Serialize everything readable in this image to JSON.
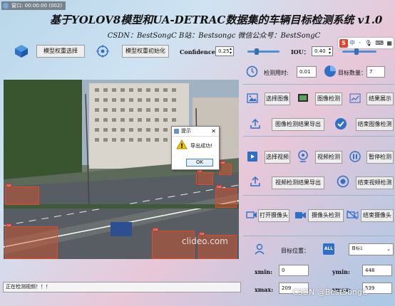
{
  "window": {
    "title": "窗口: 00:00:00 (002)"
  },
  "header": {
    "title": "基于YOLOV8模型和UA-DETRAC数据集的车辆目标检测系统 v1.0",
    "subtitle": "CSDN：BestSongC   B站：Bestsongc   微信公众号：BestSongC"
  },
  "toolbar": {
    "model_select": "模型权重选择",
    "model_init": "模型权重初始化",
    "confidence_label": "Confidence:",
    "confidence_value": "0.25",
    "confidence_level": 0.25,
    "iou_label": "IOU：",
    "iou_value": "0.40",
    "iou_level": 0.4
  },
  "ime": {
    "brand": "S",
    "lang": "中"
  },
  "stats": {
    "time_label": "检测用时:",
    "time_value": "0.01",
    "count_label": "目标数量：",
    "count_value": "7"
  },
  "image_panel": {
    "select_image": "选择图像",
    "detect_image": "图像检测",
    "show_result": "结果展示",
    "export_image": "图像检测结果导出",
    "end_image": "结束图像检测"
  },
  "video_panel": {
    "select_video": "选择视频",
    "detect_video": "视频检测",
    "pause": "暂停检测",
    "export_video": "视频检测结果导出",
    "end_video": "结束视频检测"
  },
  "camera_panel": {
    "open_camera": "打开摄像头",
    "detect_camera": "摄像头检测",
    "end_camera": "结束摄像头"
  },
  "target": {
    "label": "目标位置：",
    "badge": "ALL",
    "selected": "目标1",
    "xmin_label": "xmin:",
    "xmin": "0",
    "ymin_label": "ymin:",
    "ymin": "448",
    "xmax_label": "xmax:",
    "xmax": "209",
    "ymax_label": "ymax:",
    "ymax": "539"
  },
  "dialog": {
    "title": "提示",
    "message": "导出成功!",
    "ok": "OK"
  },
  "detections": [
    "car",
    "car",
    "car",
    "car",
    "car",
    "car",
    "car"
  ],
  "status": {
    "text": "正在检测视频！！！"
  },
  "watermark": "CSDN @BestSongC",
  "video_watermark": "clideo.com",
  "colors": {
    "accent": "#2f6fc7",
    "bbox": "#e04a2a"
  }
}
